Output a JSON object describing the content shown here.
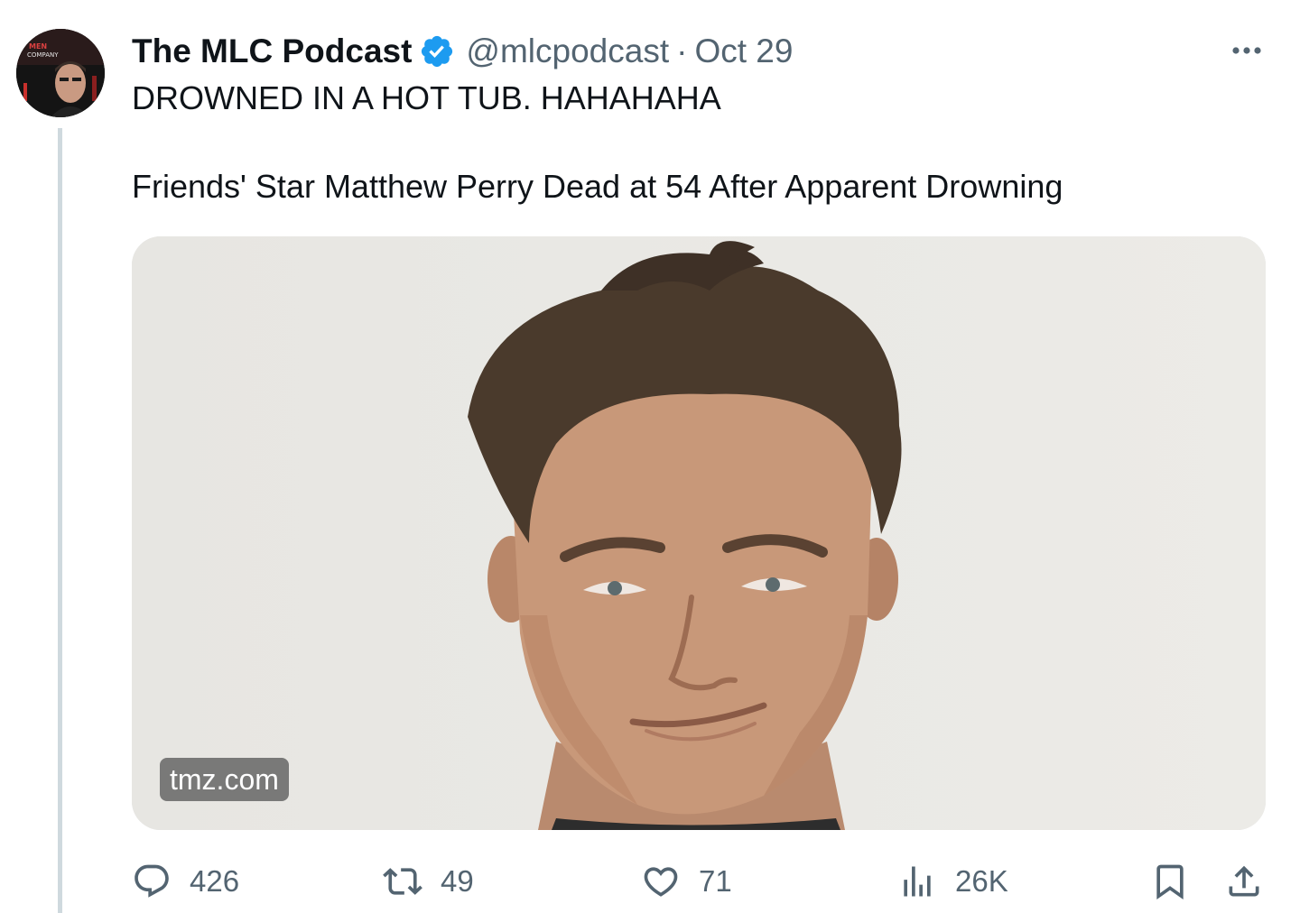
{
  "tweet": {
    "author": {
      "display_name": "The MLC Podcast",
      "handle": "@mlcpodcast",
      "verified": true,
      "verified_color": "#1d9bf0"
    },
    "separator": "·",
    "date": "Oct 29",
    "text_lines": [
      "DROWNED IN A HOT TUB. HAHAHAHA",
      "Friends' Star Matthew Perry Dead at 54 After Apparent Drowning"
    ],
    "link_card": {
      "domain": "tmz.com"
    },
    "stats": {
      "replies": "426",
      "retweets": "49",
      "likes": "71",
      "views": "26K"
    },
    "icons": {
      "more": "more-horizontal-icon",
      "reply": "reply-bubble-icon",
      "retweet": "retweet-icon",
      "like": "heart-icon",
      "views": "bar-chart-icon",
      "bookmark": "bookmark-icon",
      "share": "share-upload-icon"
    }
  }
}
